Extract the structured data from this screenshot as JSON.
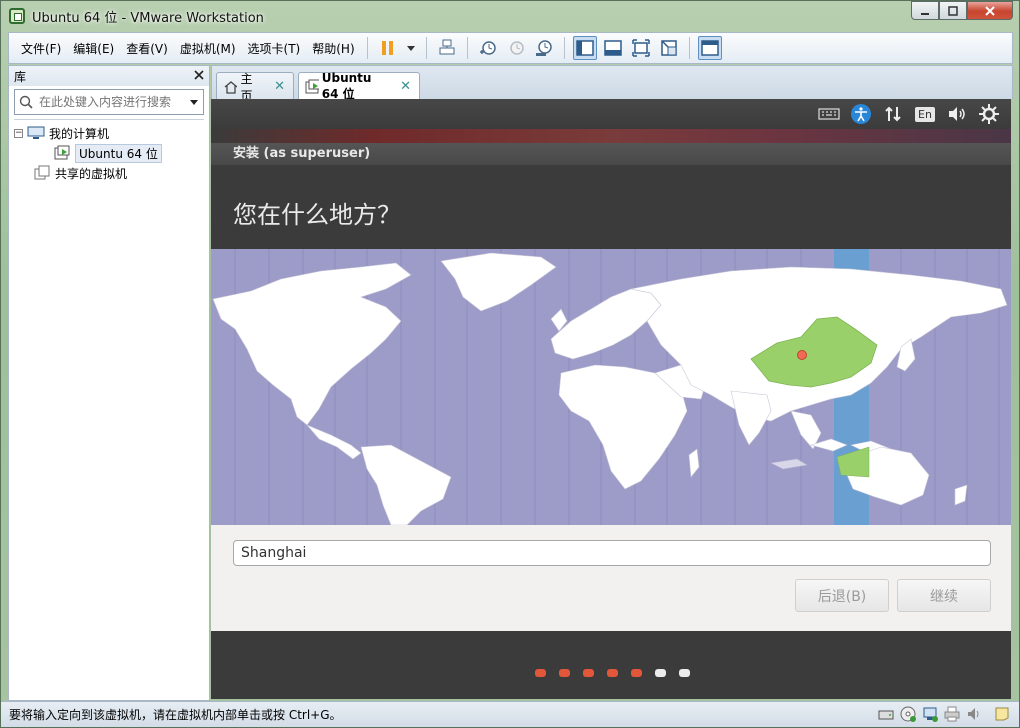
{
  "window": {
    "title": "Ubuntu 64 位 - VMware Workstation"
  },
  "menu": [
    "文件(F)",
    "编辑(E)",
    "查看(V)",
    "虚拟机(M)",
    "选项卡(T)",
    "帮助(H)"
  ],
  "toolbar_icons": [
    "pause-icon",
    "dropdown-arrow-icon",
    "send-keys-icon",
    "snapshot-take-icon",
    "snapshot-revert-icon",
    "snapshot-manager-icon",
    "library-view-icon",
    "thumbnail-bar-icon",
    "fullscreen-icon",
    "unity-icon",
    "console-view-icon"
  ],
  "library": {
    "title": "库",
    "search_placeholder": "在此处键入内容进行搜索",
    "tree": [
      {
        "label": "我的计算机",
        "level": 0,
        "toggle": "−"
      },
      {
        "label": "Ubuntu 64 位",
        "level": 1,
        "selected": true
      },
      {
        "label": "共享的虚拟机",
        "level": 0
      }
    ]
  },
  "tabs": [
    {
      "label": "主页",
      "active": false
    },
    {
      "label": "Ubuntu 64 位",
      "active": true
    }
  ],
  "ubuntu": {
    "panel_indicators": [
      "keyboard-icon",
      "accessibility-icon",
      "network-icon",
      "En",
      "volume-icon",
      "settings-gear-icon"
    ],
    "dialog_title": "安装 (as superuser)",
    "heading": "您在什么地方？",
    "location_value": "Shanghai",
    "back_button": "后退(B)",
    "continue_button": "继续",
    "progress": {
      "total_steps": 7,
      "completed_steps": 5
    },
    "colors": {
      "dot_active": "#e2573a",
      "dot_inactive": "#ececec",
      "ocean": "#9d9bc8",
      "land": "#ffffff",
      "selected_country": "#9ad06a",
      "timezone_band": "#6a9fd1"
    }
  },
  "status": {
    "message": "要将输入定向到该虚拟机，请在虚拟机内部单击或按 Ctrl+G。"
  },
  "status_icons": [
    "hard-disk-icon",
    "cd-dvd-icon",
    "network-adapter-icon",
    "printer-icon",
    "sound-icon",
    "message-log-icon"
  ]
}
